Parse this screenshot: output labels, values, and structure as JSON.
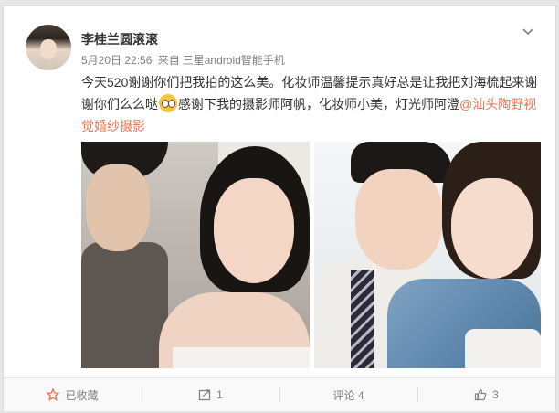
{
  "post": {
    "author": "李桂兰圆滚滚",
    "date": "5月20日 22:56",
    "source_prefix": "来自",
    "source": "三星android智能手机",
    "text_part1": "今天520谢谢你们把我拍的这么美。化妆师温馨提示真好总是让我把刘海梳起来谢谢你们么么哒",
    "emoji_name": "smile-emoji",
    "text_part2": "感谢下我的摄影师阿帆，化妆师小美，灯光师阿澄",
    "mention": "@汕头陶野视觉婚纱摄影"
  },
  "footer": {
    "favorite_label": "已收藏",
    "repost_count": "1",
    "comment_label": "评论 4",
    "like_count": "3"
  },
  "colors": {
    "link": "#eb7350",
    "favorite_star": "#eb7350"
  }
}
